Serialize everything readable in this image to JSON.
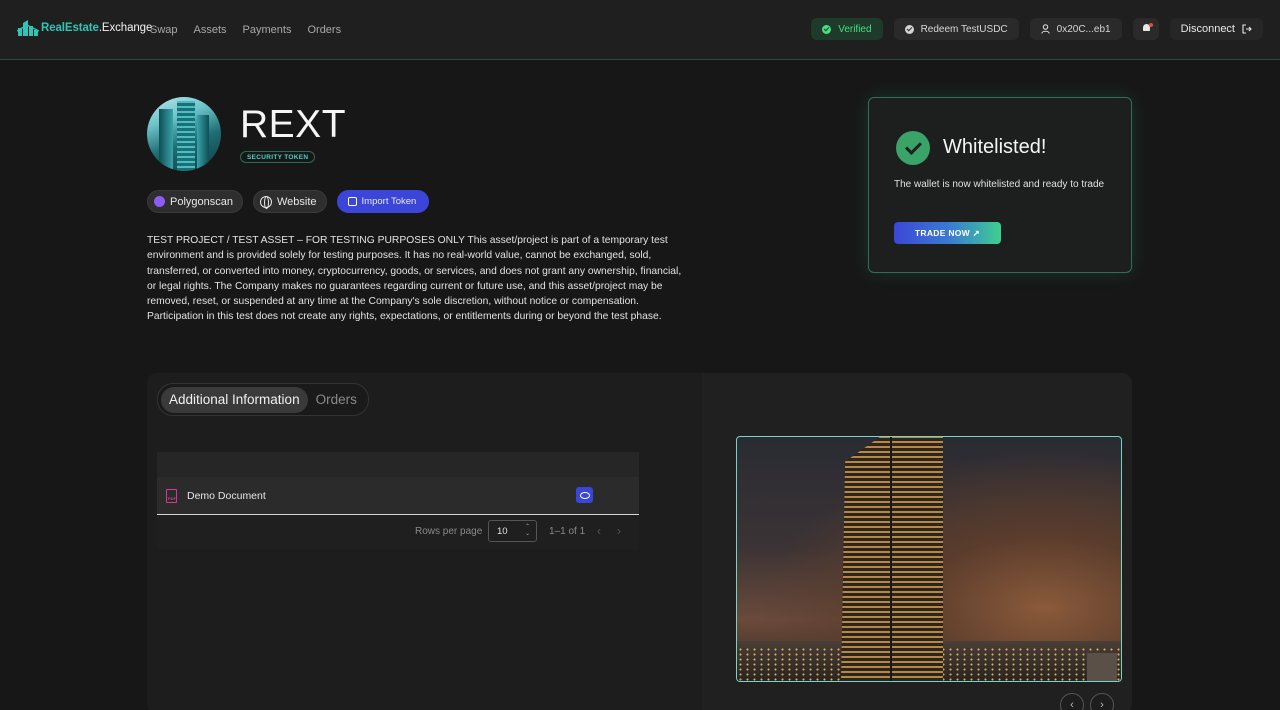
{
  "nav": {
    "logo_part1": "RealEstate",
    "logo_part2": ".Exchange",
    "links": [
      "Swap",
      "Assets",
      "Payments",
      "Orders"
    ],
    "verified_label": "Verified",
    "redeem_label": "Redeem TestUSDC",
    "wallet_address": "0x20C...eb1",
    "disconnect_label": "Disconnect"
  },
  "asset": {
    "title": "REXT",
    "badge": "SECURITY TOKEN",
    "links": {
      "polygonscan": "Polygonscan",
      "website": "Website",
      "import_token": "Import Token"
    },
    "description": "TEST PROJECT / TEST ASSET – FOR TESTING PURPOSES ONLY This asset/project is part of a temporary test environment and is provided solely for testing purposes. It has no real-world value, cannot be exchanged, sold, transferred, or converted into money, cryptocurrency, goods, or services, and does not grant any ownership, financial, or legal rights. The Company makes no guarantees regarding current or future use, and this asset/project may be removed, reset, or suspended at any time at the Company's sole discretion, without notice or compensation. Participation in this test does not create any rights, expectations, or entitlements during or beyond the test phase."
  },
  "whitelist": {
    "title": "Whitelisted!",
    "message": "The wallet is now whitelisted and ready to trade",
    "trade_button": "TRADE NOW ↗"
  },
  "tabs": [
    "Additional Information",
    "Orders"
  ],
  "documents": {
    "rows": [
      {
        "name": "Demo Document"
      }
    ],
    "rows_per_page_label": "Rows per page",
    "rows_per_page_value": "10",
    "range": "1–1 of 1"
  },
  "colors": {
    "accent_teal": "#2ec4b6",
    "primary_blue": "#3b46d8",
    "success_green": "#4ade80"
  }
}
